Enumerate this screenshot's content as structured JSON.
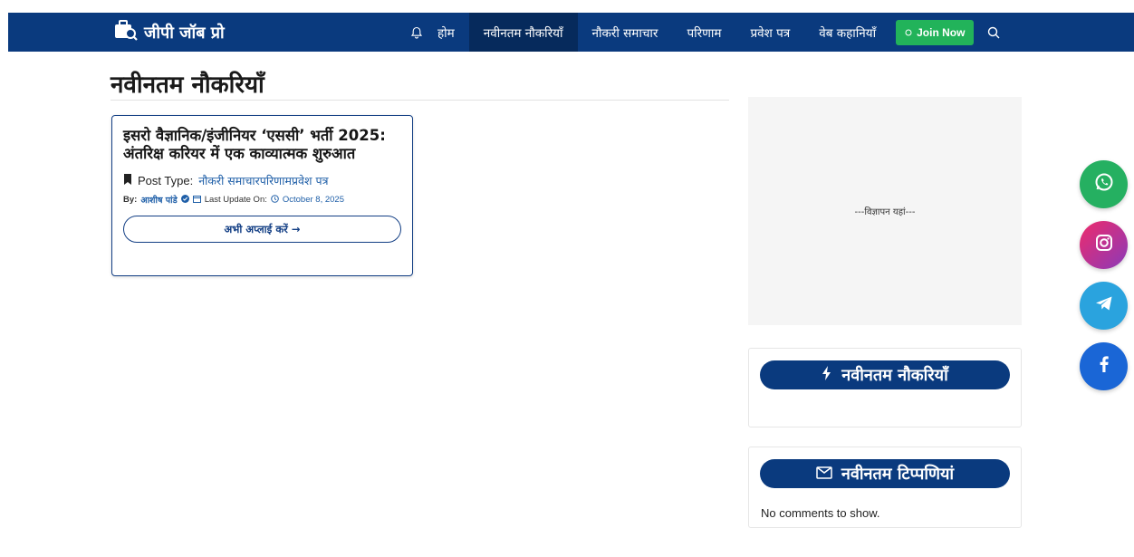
{
  "header": {
    "site_name": "जीपी जॉब प्रो",
    "nav": [
      {
        "label": "होम"
      },
      {
        "label": "नवीनतम नौकरियाँ"
      },
      {
        "label": "नौकरी समाचार"
      },
      {
        "label": "परिणाम"
      },
      {
        "label": "प्रवेश पत्र"
      },
      {
        "label": "वेब कहानियाँ"
      }
    ],
    "join_label": "Join Now",
    "colors": {
      "bar": "#0a3a7e",
      "join": "#22b35a"
    }
  },
  "main": {
    "title": "नवीनतम नौकरियाँ",
    "card": {
      "title": "इसरो वैज्ञानिक/इंजीनियर ‘एससी’ भर्ती 2025: अंतरिक्ष करियर में एक काव्यात्मक शुरुआत",
      "post_type_label": "Post Type:",
      "post_type_value": "नौकरी समाचारपरिणामप्रवेश पत्र",
      "by_label": "By:",
      "author": "आशीष पांडे",
      "last_update_label": "Last Update On:",
      "date": "October 8, 2025",
      "apply_label": "अभी अप्लाई करें →"
    }
  },
  "sidebar": {
    "ad_text": "---विज्ञापन यहां---",
    "latest_jobs_title": "नवीनतम नौकरियाँ",
    "latest_comments_title": "नवीनतम टिप्पणियां",
    "no_comments": "No comments to show."
  },
  "social": [
    {
      "icon": "whatsapp-icon",
      "color": "#25b061"
    },
    {
      "icon": "instagram-icon",
      "color": "#c1358f"
    },
    {
      "icon": "telegram-icon",
      "color": "#2aa3de"
    },
    {
      "icon": "facebook-icon",
      "color": "#1a66d6"
    }
  ]
}
